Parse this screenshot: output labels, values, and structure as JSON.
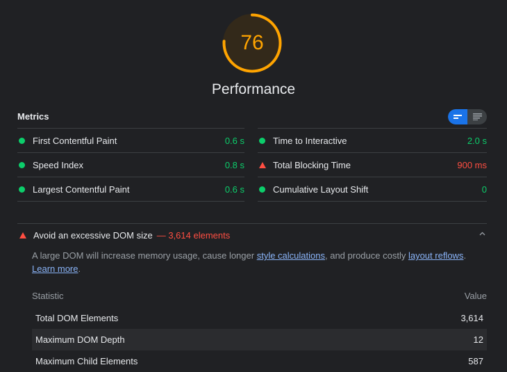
{
  "score": {
    "value": "76",
    "fraction": 0.76,
    "category": "Performance",
    "color": "#ffa400"
  },
  "metrics": {
    "title": "Metrics",
    "toggle": {
      "active": "expanded-view-icon",
      "inactive": "list-view-icon"
    },
    "left": [
      {
        "label": "First Contentful Paint",
        "value": "0.6 s",
        "status": "pass"
      },
      {
        "label": "Speed Index",
        "value": "0.8 s",
        "status": "pass"
      },
      {
        "label": "Largest Contentful Paint",
        "value": "0.6 s",
        "status": "pass"
      }
    ],
    "right": [
      {
        "label": "Time to Interactive",
        "value": "2.0 s",
        "status": "pass"
      },
      {
        "label": "Total Blocking Time",
        "value": "900 ms",
        "status": "fail"
      },
      {
        "label": "Cumulative Layout Shift",
        "value": "0",
        "status": "pass"
      }
    ]
  },
  "audit": {
    "title": "Avoid an excessive DOM size",
    "display_value": "— 3,614 elements",
    "description": {
      "prefix": "A large DOM will increase memory usage, cause longer ",
      "link1": "style calculations",
      "middle": ", and produce costly ",
      "link2": "layout reflows",
      "sep": ". ",
      "link3": "Learn more",
      "suffix": "."
    },
    "table": {
      "headers": [
        "Statistic",
        "Value"
      ],
      "rows": [
        [
          "Total DOM Elements",
          "3,614"
        ],
        [
          "Maximum DOM Depth",
          "12"
        ],
        [
          "Maximum Child Elements",
          "587"
        ]
      ]
    }
  },
  "colors": {
    "pass": "#0cce6b",
    "fail": "#ff4e42",
    "average": "#ffa400",
    "link": "#8ab4f8",
    "toggle_active": "#1a73e8"
  }
}
